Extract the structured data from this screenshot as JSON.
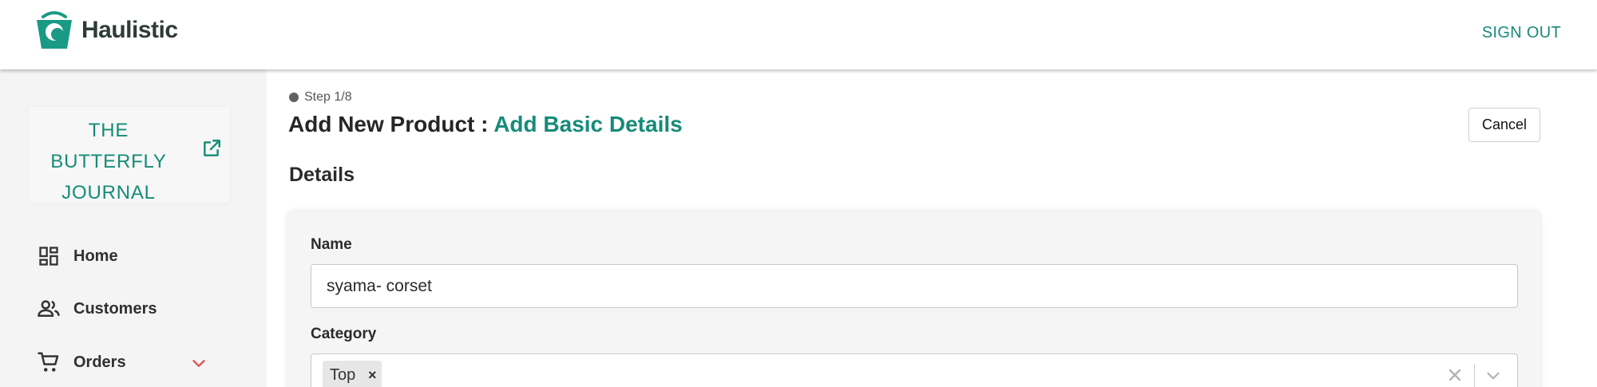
{
  "header": {
    "app_name": "Haulistic",
    "sign_out_label": "SIGN OUT"
  },
  "sidebar": {
    "brand": {
      "name": "THE BUTTERFLY JOURNAL"
    },
    "items": [
      {
        "label": "Home",
        "icon": "dashboard-icon"
      },
      {
        "label": "Customers",
        "icon": "people-icon"
      },
      {
        "label": "Orders",
        "icon": "cart-icon",
        "expandable": true
      }
    ]
  },
  "main": {
    "step": "Step 1/8",
    "title_prefix": "Add New Product : ",
    "title_accent": "Add Basic Details",
    "cancel_label": "Cancel",
    "section_title": "Details",
    "form": {
      "name_label": "Name",
      "name_value": "syama- corset",
      "category_label": "Category",
      "category_selected": [
        "Top"
      ],
      "chip_remove_glyph": "×"
    }
  },
  "colors": {
    "accent": "#168b78",
    "header_bg": "#ffffff",
    "sidebar_bg": "#f3f4f3",
    "card_bg": "#f4f5f4",
    "chevron": "#e05555"
  }
}
